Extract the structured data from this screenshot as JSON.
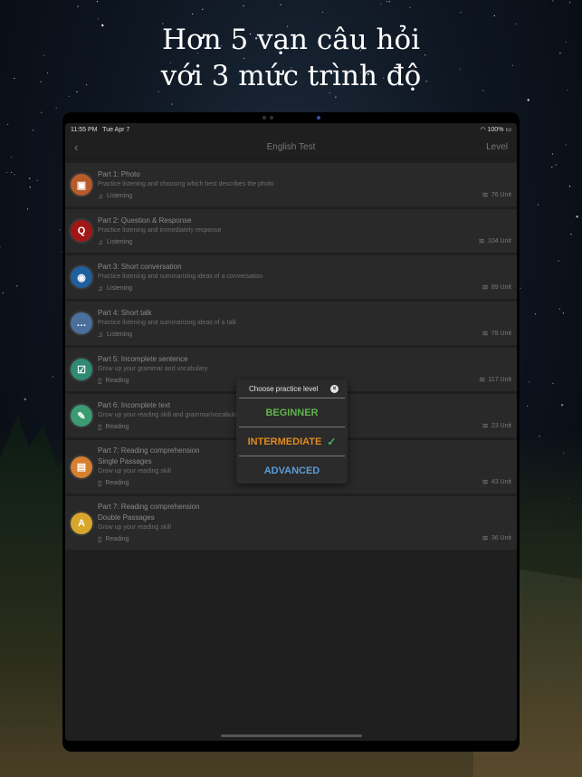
{
  "headline": {
    "line1": "Hơn 5 vạn câu hỏi",
    "line2": "với 3 mức trình độ"
  },
  "status": {
    "time": "11:55 PM",
    "date": "Tue Apr 7",
    "battery": "100%"
  },
  "nav": {
    "back_icon": "chevron-left-icon",
    "title": "English Test",
    "right": "Level"
  },
  "parts": [
    {
      "title": "Part 1: Photo",
      "subtitle": "",
      "desc": "Practice listening and choosing which best describes the photo",
      "skill": "Listening",
      "units": "76 Unit",
      "icon": "photo-icon",
      "icon_color": "#b85a2a"
    },
    {
      "title": "Part 2: Question & Response",
      "subtitle": "",
      "desc": "Practice listening and immediately response",
      "skill": "Listening",
      "units": "104 Unit",
      "icon": "q-icon",
      "icon_color": "#a11616"
    },
    {
      "title": "Part 3: Short conversation",
      "subtitle": "",
      "desc": "Practice listening and summarizing ideas of a conversation",
      "skill": "Listening",
      "units": "89 Unit",
      "icon": "chat-icon",
      "icon_color": "#1f5f9e"
    },
    {
      "title": "Part 4: Short talk",
      "subtitle": "",
      "desc": "Practice listening and summarizing ideas of a talk",
      "skill": "Listening",
      "units": "78 Unit",
      "icon": "speech-icon",
      "icon_color": "#4a6f9c"
    },
    {
      "title": "Part 5: Incomplete sentence",
      "subtitle": "",
      "desc": "Grow up your grammar and vocabulary",
      "skill": "Reading",
      "units": "117 Unit",
      "icon": "checklist-icon",
      "icon_color": "#2f8a73"
    },
    {
      "title": "Part 6: Incomplete text",
      "subtitle": "",
      "desc": "Grow up your reading skill and grammar/vocabulary",
      "skill": "Reading",
      "units": "23 Unit",
      "icon": "edit-icon",
      "icon_color": "#3b9b73"
    },
    {
      "title": "Part 7: Reading comprehension",
      "subtitle": "Single Passages",
      "desc": "Grow up your reading skill",
      "skill": "Reading",
      "units": "43 Unit",
      "icon": "document-icon",
      "icon_color": "#d67f2e"
    },
    {
      "title": "Part 7: Reading comprehension",
      "subtitle": "Double Passages",
      "desc": "Grow up your reading skill",
      "skill": "Reading",
      "units": "36 Unit",
      "icon": "letter-a-icon",
      "icon_color": "#d8a62a"
    }
  ],
  "modal": {
    "title": "Choose practice level",
    "options": [
      {
        "label": "BEGINNER",
        "color": "#5fb34e",
        "selected": false
      },
      {
        "label": "INTERMEDIATE",
        "color": "#e08a1e",
        "selected": true
      },
      {
        "label": "ADVANCED",
        "color": "#5b9bd6",
        "selected": false
      }
    ]
  }
}
